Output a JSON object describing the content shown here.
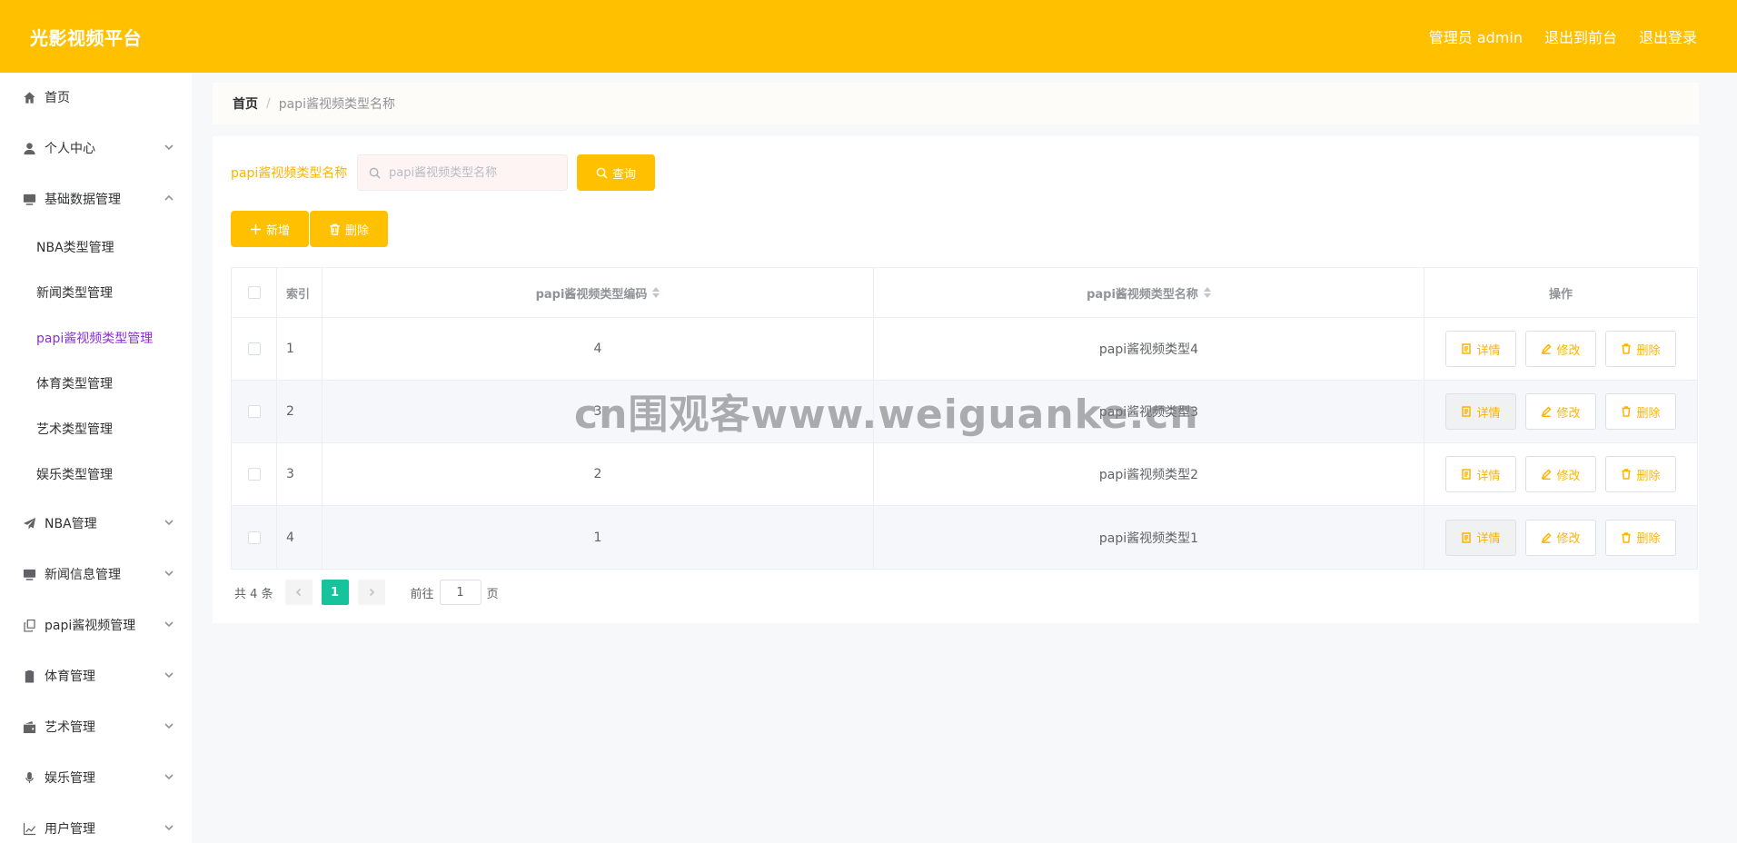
{
  "header": {
    "app_title": "光影视频平台",
    "admin_label": "管理员 admin",
    "to_front": "退出到前台",
    "logout": "退出登录",
    "bg_color": "#ffc000"
  },
  "sidebar": {
    "items": [
      {
        "label": "首页",
        "icon": "home-icon"
      },
      {
        "label": "个人中心",
        "icon": "user-icon"
      },
      {
        "label": "基础数据管理",
        "icon": "monitor-icon"
      },
      {
        "label": "NBA管理",
        "icon": "paper-plane-icon"
      },
      {
        "label": "新闻信息管理",
        "icon": "monitor-icon"
      },
      {
        "label": "papi酱视频管理",
        "icon": "copy-icon"
      },
      {
        "label": "体育管理",
        "icon": "clipboard-icon"
      },
      {
        "label": "艺术管理",
        "icon": "wallet-icon"
      },
      {
        "label": "娱乐管理",
        "icon": "microphone-icon"
      },
      {
        "label": "用户管理",
        "icon": "chart-icon"
      }
    ],
    "submenu": [
      "NBA类型管理",
      "新闻类型管理",
      "papi酱视频类型管理",
      "体育类型管理",
      "艺术类型管理",
      "娱乐类型管理"
    ],
    "active_color": "#8b2fd6"
  },
  "breadcrumb": {
    "home": "首页",
    "separator": "/",
    "current": "papi酱视频类型名称"
  },
  "search": {
    "label": "papi酱视频类型名称",
    "placeholder": "papi酱视频类型名称",
    "button": "查询"
  },
  "actions": {
    "add": "新增",
    "delete": "删除"
  },
  "table": {
    "headers": {
      "index": "索引",
      "code": "papi酱视频类型编码",
      "name": "papi酱视频类型名称",
      "ops": "操作"
    },
    "rows": [
      {
        "index": "1",
        "code": "4",
        "name": "papi酱视频类型4"
      },
      {
        "index": "2",
        "code": "3",
        "name": "papi酱视频类型3"
      },
      {
        "index": "3",
        "code": "2",
        "name": "papi酱视频类型2"
      },
      {
        "index": "4",
        "code": "1",
        "name": "papi酱视频类型1"
      }
    ],
    "op_labels": {
      "detail": "详情",
      "edit": "修改",
      "delete": "删除"
    }
  },
  "pagination": {
    "total": "共 4 条",
    "current_page": "1",
    "goto_label": "前往",
    "goto_value": "1",
    "page_suffix": "页"
  },
  "watermark": "cn围观客www.weiguanke.cn"
}
